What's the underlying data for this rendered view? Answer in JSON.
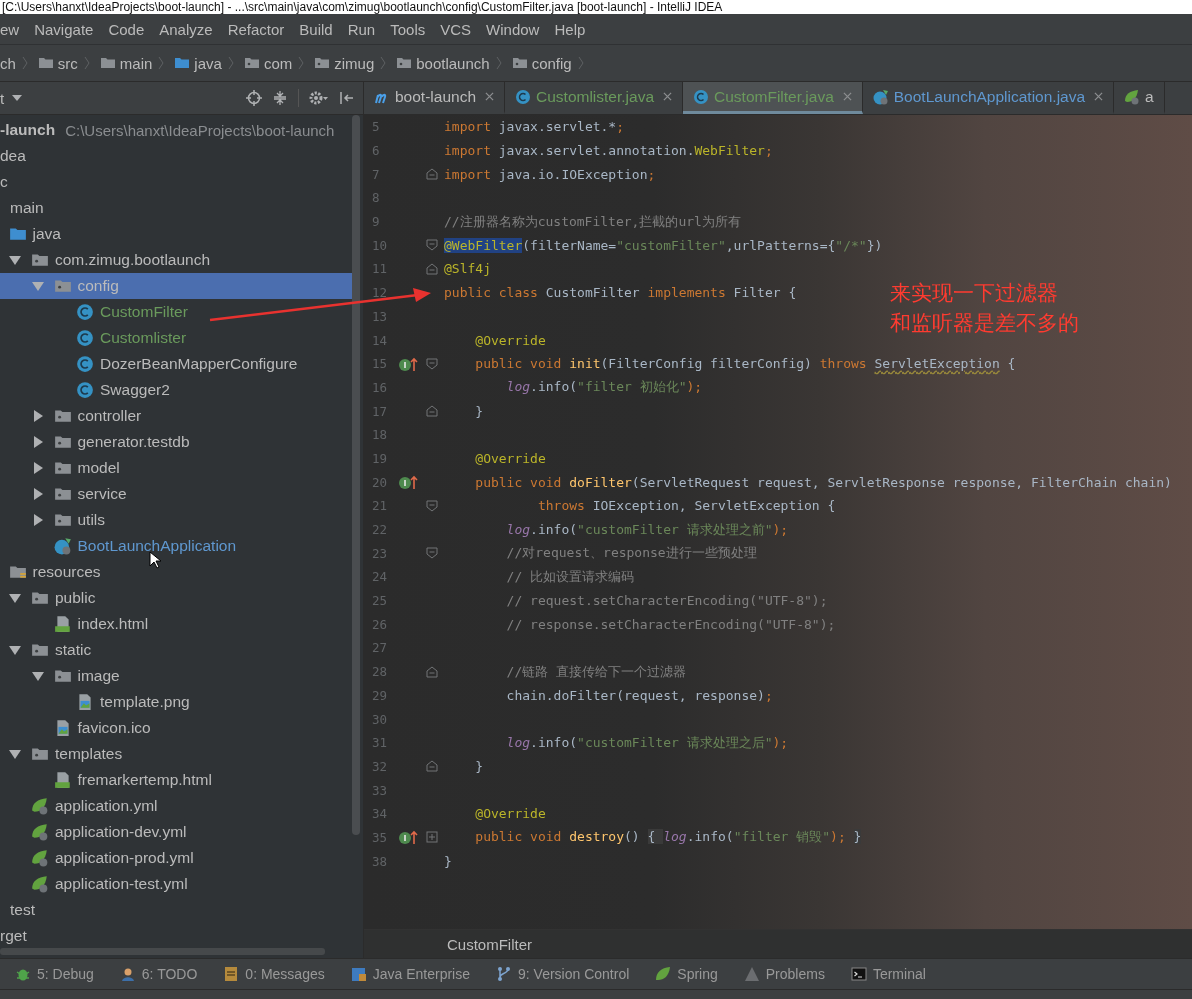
{
  "title_bar": {
    "title": "[C:\\Users\\hanxt\\IdeaProjects\\boot-launch] - ...\\src\\main\\java\\com\\zimug\\bootlaunch\\config\\CustomFilter.java [boot-launch] - IntelliJ IDEA"
  },
  "menu": [
    "ew",
    "Navigate",
    "Code",
    "Analyze",
    "Refactor",
    "Build",
    "Run",
    "Tools",
    "VCS",
    "Window",
    "Help"
  ],
  "breadcrumbs": [
    {
      "label": "ch",
      "kind": "module"
    },
    {
      "label": "src",
      "kind": "folder"
    },
    {
      "label": "main",
      "kind": "folder"
    },
    {
      "label": "java",
      "kind": "source"
    },
    {
      "label": "com",
      "kind": "package"
    },
    {
      "label": "zimug",
      "kind": "package"
    },
    {
      "label": "bootlaunch",
      "kind": "package"
    },
    {
      "label": "config",
      "kind": "package"
    }
  ],
  "project_panel": {
    "title": "t",
    "tree": [
      {
        "label": "-launch",
        "path": "C:\\Users\\hanxt\\IdeaProjects\\boot-launch",
        "selected": false,
        "children": [
          {
            "label": "dea",
            "selected": false
          },
          {
            "label": "c",
            "selected": false,
            "children": [
              {
                "label": "main",
                "selected": false,
                "children": [
                  {
                    "label": "java",
                    "kind": "source",
                    "selected": false,
                    "children": [
                      {
                        "label": "com.zimug.bootlaunch",
                        "kind": "package",
                        "expanded": true,
                        "selected": false,
                        "children": [
                          {
                            "label": "config",
                            "kind": "package",
                            "expanded": true,
                            "selected": true,
                            "children": [
                              {
                                "label": "CustomFilter",
                                "kind": "class",
                                "color": "#6a9a5c",
                                "selected": false
                              },
                              {
                                "label": "Customlister",
                                "kind": "class",
                                "color": "#6a9a5c",
                                "selected": false
                              },
                              {
                                "label": "DozerBeanMapperConfigure",
                                "kind": "class",
                                "selected": false
                              },
                              {
                                "label": "Swagger2",
                                "kind": "class",
                                "selected": false
                              }
                            ]
                          },
                          {
                            "label": "controller",
                            "kind": "package",
                            "expanded": false,
                            "selected": false
                          },
                          {
                            "label": "generator.testdb",
                            "kind": "package",
                            "expanded": false,
                            "selected": false
                          },
                          {
                            "label": "model",
                            "kind": "package",
                            "expanded": false,
                            "selected": false
                          },
                          {
                            "label": "service",
                            "kind": "package",
                            "expanded": false,
                            "selected": false
                          },
                          {
                            "label": "utils",
                            "kind": "package",
                            "expanded": false,
                            "selected": false
                          },
                          {
                            "label": "BootLaunchApplication",
                            "kind": "spring-class",
                            "color": "#5f98d0",
                            "selected": false
                          }
                        ]
                      }
                    ]
                  },
                  {
                    "label": "resources",
                    "kind": "resources",
                    "selected": false,
                    "children": [
                      {
                        "label": "public",
                        "kind": "package",
                        "expanded": true,
                        "selected": false,
                        "children": [
                          {
                            "label": "index.html",
                            "kind": "html",
                            "selected": false
                          }
                        ]
                      },
                      {
                        "label": "static",
                        "kind": "package",
                        "expanded": true,
                        "selected": false,
                        "children": [
                          {
                            "label": "image",
                            "kind": "package",
                            "expanded": true,
                            "selected": false,
                            "children": [
                              {
                                "label": "template.png",
                                "kind": "image",
                                "selected": false
                              }
                            ]
                          },
                          {
                            "label": "favicon.ico",
                            "kind": "image",
                            "selected": false
                          }
                        ]
                      },
                      {
                        "label": "templates",
                        "kind": "package",
                        "expanded": true,
                        "selected": false,
                        "children": [
                          {
                            "label": "fremarkertemp.html",
                            "kind": "html",
                            "selected": false
                          }
                        ]
                      },
                      {
                        "label": "application.yml",
                        "kind": "yml",
                        "selected": false
                      },
                      {
                        "label": "application-dev.yml",
                        "kind": "yml",
                        "selected": false
                      },
                      {
                        "label": "application-prod.yml",
                        "kind": "yml",
                        "selected": false
                      },
                      {
                        "label": "application-test.yml",
                        "kind": "yml",
                        "selected": false
                      }
                    ]
                  }
                ]
              },
              {
                "label": "test",
                "selected": false
              }
            ]
          },
          {
            "label": "rget",
            "selected": false
          }
        ]
      }
    ]
  },
  "editor_tabs": [
    {
      "label": "boot-launch",
      "kind": "maven",
      "closable": true,
      "selected": false
    },
    {
      "label": "Customlister.java",
      "kind": "class",
      "color": "#6a9a5c",
      "closable": true,
      "selected": false
    },
    {
      "label": "CustomFilter.java",
      "kind": "class",
      "color": "#6a9a5c",
      "closable": true,
      "selected": true
    },
    {
      "label": "BootLaunchApplication.java",
      "kind": "spring-class",
      "color": "#5f98d0",
      "closable": true,
      "selected": false
    },
    {
      "label": "a",
      "kind": "yml",
      "closable": false,
      "selected": false
    }
  ],
  "code_lines": [
    {
      "n": "5",
      "segs": [
        {
          "t": "import",
          "kind": "kw"
        },
        {
          "t": " javax.servlet.*",
          "kind": "plain"
        },
        {
          "t": ";",
          "kind": "kw"
        }
      ]
    },
    {
      "n": "6",
      "segs": [
        {
          "t": "import",
          "kind": "kw"
        },
        {
          "t": " javax.servlet.annotation.",
          "kind": "plain"
        },
        {
          "t": "WebFilter",
          "kind": "ann"
        },
        {
          "t": ";",
          "kind": "kw"
        }
      ]
    },
    {
      "n": "7",
      "fold_end": true,
      "segs": [
        {
          "t": "import",
          "kind": "kw"
        },
        {
          "t": " java.io.IOException",
          "kind": "plain"
        },
        {
          "t": ";",
          "kind": "kw"
        }
      ]
    },
    {
      "n": "8"
    },
    {
      "n": "9",
      "segs": [
        {
          "t": "//注册器名称为customFilter,拦截的url为所有",
          "kind": "com"
        }
      ]
    },
    {
      "n": "10",
      "fold_start": true,
      "segs": [
        {
          "t": "@WebFilter",
          "kind": "anns"
        },
        {
          "t": "(filterName=",
          "kind": "plain"
        },
        {
          "t": "\"customFilter\"",
          "kind": "str"
        },
        {
          "t": ",urlPatterns={",
          "kind": "plain"
        },
        {
          "t": "\"/*\"",
          "kind": "str"
        },
        {
          "t": "})",
          "kind": "plain"
        }
      ]
    },
    {
      "n": "11",
      "fold_end": true,
      "segs": [
        {
          "t": "@Slf4j",
          "kind": "ann"
        }
      ]
    },
    {
      "n": "12",
      "segs": [
        {
          "t": "public class ",
          "kind": "kw"
        },
        {
          "t": "CustomFilter ",
          "kind": "plain"
        },
        {
          "t": "implements ",
          "kind": "kw"
        },
        {
          "t": "Filter {",
          "kind": "plain"
        }
      ]
    },
    {
      "n": "13"
    },
    {
      "n": "14",
      "segs": [
        {
          "t": "    @Override",
          "kind": "ann"
        }
      ]
    },
    {
      "n": "15",
      "override": true,
      "fold_start": true,
      "segs": [
        {
          "t": "    public void ",
          "kind": "kw"
        },
        {
          "t": "init",
          "kind": "fn"
        },
        {
          "t": "(FilterConfig filterConfig) ",
          "kind": "plain"
        },
        {
          "t": "throws ",
          "kind": "kw"
        },
        {
          "t": "ServletException",
          "kind": "warn"
        },
        {
          "t": " {",
          "kind": "plain"
        }
      ]
    },
    {
      "n": "16",
      "segs": [
        {
          "t": "        log",
          "kind": "stat"
        },
        {
          "t": ".info(",
          "kind": "plain"
        },
        {
          "t": "\"filter 初始化\"",
          "kind": "str"
        },
        {
          "t": ");",
          "kind": "kw"
        }
      ]
    },
    {
      "n": "17",
      "fold_end": true,
      "segs": [
        {
          "t": "    }",
          "kind": "plain"
        }
      ]
    },
    {
      "n": "18"
    },
    {
      "n": "19",
      "segs": [
        {
          "t": "    @Override",
          "kind": "ann"
        }
      ]
    },
    {
      "n": "20",
      "override": true,
      "segs": [
        {
          "t": "    public void ",
          "kind": "kw"
        },
        {
          "t": "doFilter",
          "kind": "fn"
        },
        {
          "t": "(ServletRequest request, ServletResponse response, FilterChain chain)",
          "kind": "plain"
        }
      ]
    },
    {
      "n": "21",
      "fold_start": true,
      "segs": [
        {
          "t": "            throws ",
          "kind": "kw"
        },
        {
          "t": "IOException, ServletException {",
          "kind": "plain"
        }
      ]
    },
    {
      "n": "22",
      "segs": [
        {
          "t": "        log",
          "kind": "stat"
        },
        {
          "t": ".info(",
          "kind": "plain"
        },
        {
          "t": "\"customFilter 请求处理之前\"",
          "kind": "str"
        },
        {
          "t": ");",
          "kind": "kw"
        }
      ]
    },
    {
      "n": "23",
      "fold_start": true,
      "segs": [
        {
          "t": "        //对request、response进行一些预处理",
          "kind": "com"
        }
      ]
    },
    {
      "n": "24",
      "segs": [
        {
          "t": "        // 比如设置请求编码",
          "kind": "com"
        }
      ]
    },
    {
      "n": "25",
      "segs": [
        {
          "t": "        // request.setCharacterEncoding(\"UTF-8\");",
          "kind": "com"
        }
      ]
    },
    {
      "n": "26",
      "segs": [
        {
          "t": "        // response.setCharacterEncoding(\"UTF-8\");",
          "kind": "com"
        }
      ]
    },
    {
      "n": "27"
    },
    {
      "n": "28",
      "fold_end": true,
      "segs": [
        {
          "t": "        //链路 直接传给下一个过滤器",
          "kind": "com"
        }
      ]
    },
    {
      "n": "29",
      "segs": [
        {
          "t": "        chain.doFilter(request, response)",
          "kind": "plain"
        },
        {
          "t": ";",
          "kind": "kw"
        }
      ]
    },
    {
      "n": "30"
    },
    {
      "n": "31",
      "segs": [
        {
          "t": "        log",
          "kind": "stat"
        },
        {
          "t": ".info(",
          "kind": "plain"
        },
        {
          "t": "\"customFilter 请求处理之后\"",
          "kind": "str"
        },
        {
          "t": ");",
          "kind": "kw"
        }
      ]
    },
    {
      "n": "32",
      "fold_end": true,
      "segs": [
        {
          "t": "    }",
          "kind": "plain"
        }
      ]
    },
    {
      "n": "33"
    },
    {
      "n": "34",
      "segs": [
        {
          "t": "    @Override",
          "kind": "ann"
        }
      ]
    },
    {
      "n": "35",
      "override": true,
      "folded": true,
      "segs": [
        {
          "t": "    public void ",
          "kind": "kw"
        },
        {
          "t": "destroy",
          "kind": "fn"
        },
        {
          "t": "() ",
          "kind": "plain"
        },
        {
          "t": "{ ",
          "kind": "fold"
        },
        {
          "t": "log",
          "kind": "stat"
        },
        {
          "t": ".info(",
          "kind": "plain"
        },
        {
          "t": "\"filter 销毁\"",
          "kind": "str"
        },
        {
          "t": "); ",
          "kind": "kw"
        },
        {
          "t": "}",
          "kind": "fold"
        }
      ]
    },
    {
      "n": "38",
      "segs": [
        {
          "t": "}",
          "kind": "plain"
        }
      ]
    }
  ],
  "editor_breadcrumb": "CustomFilter",
  "annotation": {
    "lines": [
      "来实现一下过滤器",
      "和监听器是差不多的"
    ]
  },
  "tool_windows": [
    {
      "label": "5: Debug",
      "kind": "bug"
    },
    {
      "label": "6: TODO",
      "kind": "todo"
    },
    {
      "label": "0: Messages",
      "kind": "messages"
    },
    {
      "label": "Java Enterprise",
      "kind": "enterprise"
    },
    {
      "label": "9: Version Control",
      "kind": "vcs"
    },
    {
      "label": "Spring",
      "kind": "spring"
    },
    {
      "label": "Problems",
      "kind": "warning"
    },
    {
      "label": "Terminal",
      "kind": "terminal"
    }
  ]
}
